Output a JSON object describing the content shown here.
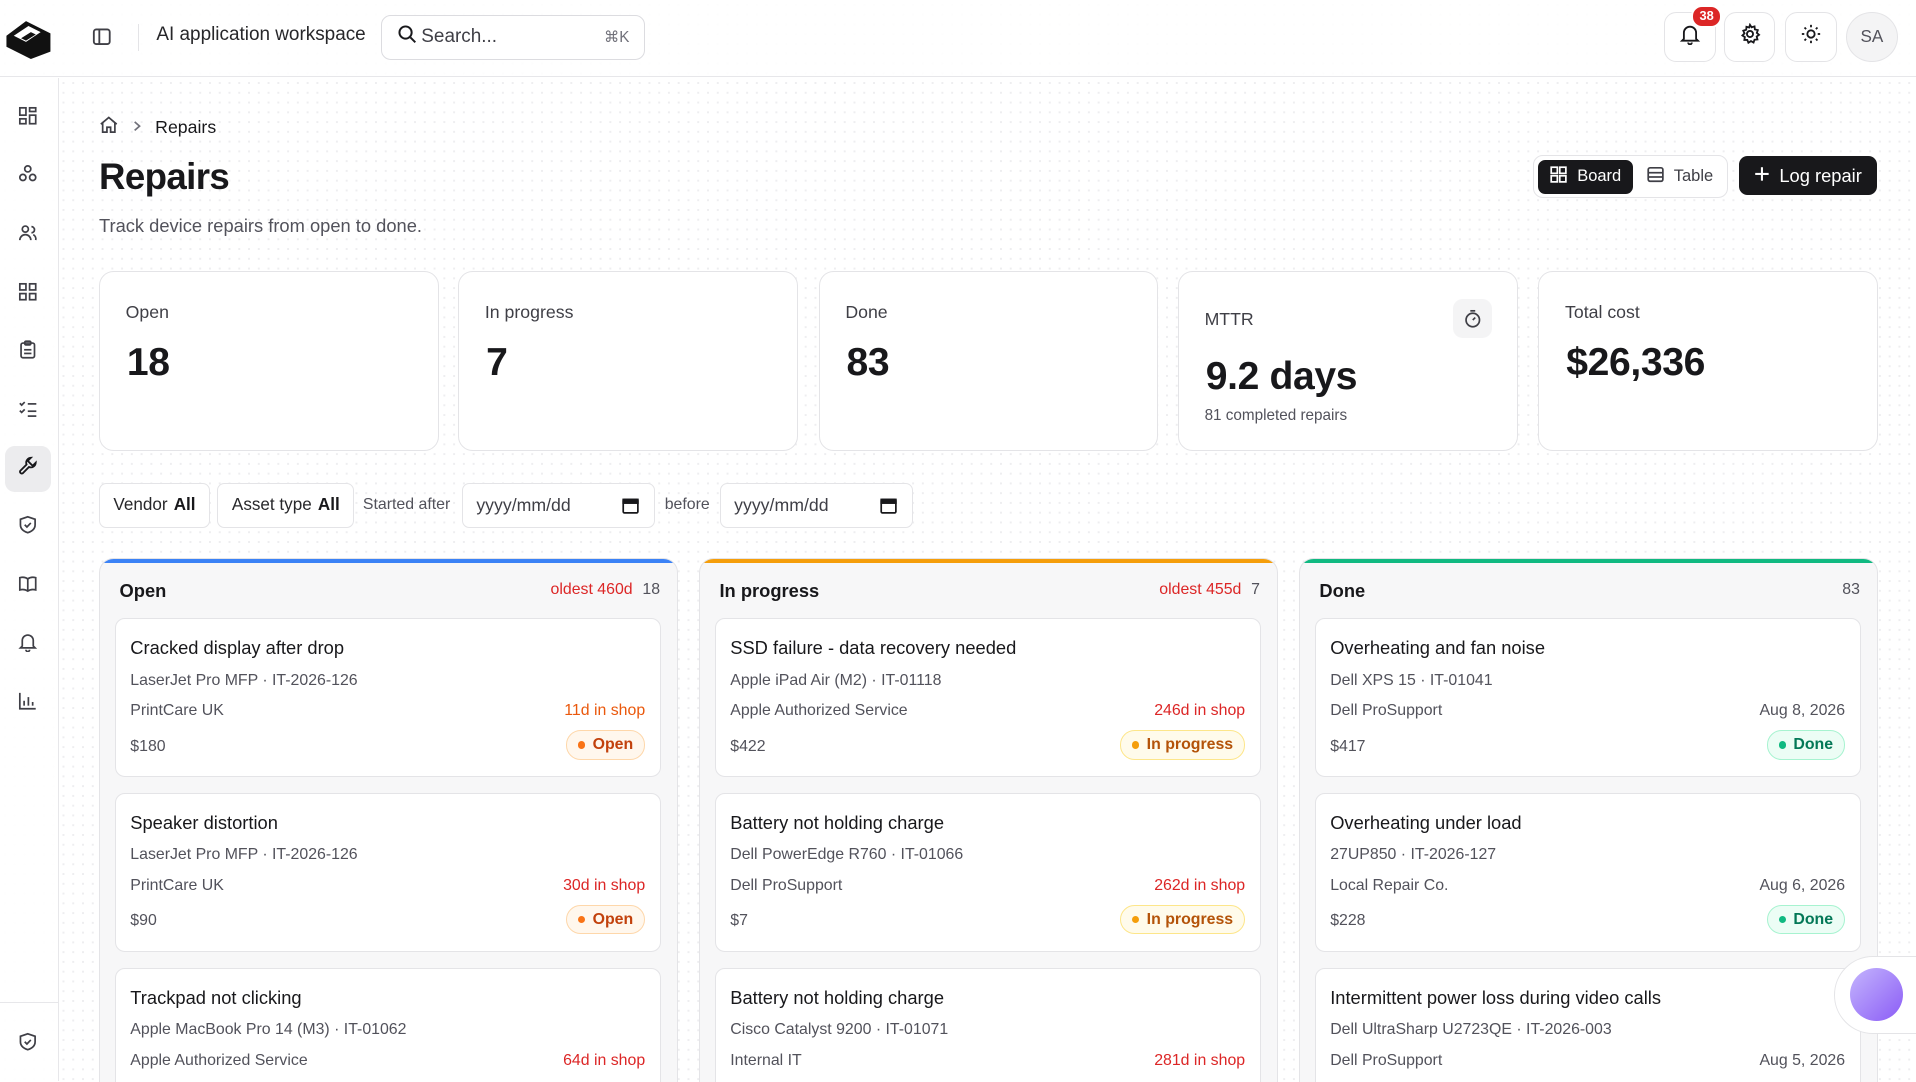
{
  "header": {
    "workspace_title": "AI application workspace",
    "search_placeholder": "Search...",
    "search_shortcut": "⌘K",
    "notification_count": "38",
    "avatar_initials": "SA"
  },
  "rail": {
    "items": [
      "dashboard-icon",
      "integrations-icon",
      "users-icon",
      "apps-icon",
      "clipboard-icon",
      "checklist-icon",
      "wrench-icon",
      "shield-icon",
      "book-icon",
      "bell-icon",
      "chart-icon"
    ],
    "active": "wrench-icon",
    "bottom": "shield-check-icon"
  },
  "breadcrumb": {
    "current": "Repairs"
  },
  "page": {
    "title": "Repairs",
    "subtitle": "Track device repairs from open to done."
  },
  "view_toggle": {
    "board": "Board",
    "table": "Table",
    "selected": "Board"
  },
  "actions": {
    "log_repair": "Log repair"
  },
  "stats": {
    "open": {
      "label": "Open",
      "value": "18"
    },
    "in_progress": {
      "label": "In progress",
      "value": "7"
    },
    "done": {
      "label": "Done",
      "value": "83"
    },
    "mttr": {
      "label": "MTTR",
      "value": "9.2 days",
      "sub": "81 completed repairs"
    },
    "total_cost": {
      "label": "Total cost",
      "value": "$26,336"
    }
  },
  "filters": {
    "vendor_label": "Vendor",
    "vendor_value": "All",
    "asset_type_label": "Asset type",
    "asset_type_value": "All",
    "started_after_label": "Started after",
    "started_after_placeholder": "yyyy/mm/dd",
    "before_label": "before",
    "before_placeholder": "yyyy/mm/dd"
  },
  "columns": [
    {
      "title": "Open",
      "oldest": "oldest 460d",
      "count": "18",
      "accent": "#3b82f6",
      "cards": [
        {
          "title": "Cracked display after drop",
          "asset": "LaserJet Pro MFP · IT-2026-126",
          "vendor": "PrintCare UK",
          "age": "11d in shop",
          "cost": "$180",
          "status": "Open"
        },
        {
          "title": "Speaker distortion",
          "asset": "LaserJet Pro MFP · IT-2026-126",
          "vendor": "PrintCare UK",
          "age": "30d in shop",
          "cost": "$90",
          "status": "Open"
        },
        {
          "title": "Trackpad not clicking",
          "asset": "Apple MacBook Pro 14 (M3) · IT-01062",
          "vendor": "Apple Authorized Service",
          "age": "64d in shop",
          "cost": "",
          "status": ""
        }
      ]
    },
    {
      "title": "In progress",
      "oldest": "oldest 455d",
      "count": "7",
      "accent": "#f59e0b",
      "cards": [
        {
          "title": "SSD failure - data recovery needed",
          "asset": "Apple iPad Air (M2) · IT-01118",
          "vendor": "Apple Authorized Service",
          "age": "246d in shop",
          "cost": "$422",
          "status": "In progress"
        },
        {
          "title": "Battery not holding charge",
          "asset": "Dell PowerEdge R760 · IT-01066",
          "vendor": "Dell ProSupport",
          "age": "262d in shop",
          "cost": "$7",
          "status": "In progress"
        },
        {
          "title": "Battery not holding charge",
          "asset": "Cisco Catalyst 9200 · IT-01071",
          "vendor": "Internal IT",
          "age": "281d in shop",
          "cost": "",
          "status": ""
        }
      ]
    },
    {
      "title": "Done",
      "oldest": "",
      "count": "83",
      "accent": "#10b981",
      "cards": [
        {
          "title": "Overheating and fan noise",
          "asset": "Dell XPS 15 · IT-01041",
          "vendor": "Dell ProSupport",
          "age": "Aug 8, 2026",
          "cost": "$417",
          "status": "Done"
        },
        {
          "title": "Overheating under load",
          "asset": "27UP850 · IT-2026-127",
          "vendor": "Local Repair Co.",
          "age": "Aug 6, 2026",
          "cost": "$228",
          "status": "Done"
        },
        {
          "title": "Intermittent power loss during video calls",
          "asset": "Dell UltraSharp U2723QE · IT-2026-003",
          "vendor": "Dell ProSupport",
          "age": "Aug 5, 2026",
          "cost": "",
          "status": ""
        }
      ]
    }
  ]
}
